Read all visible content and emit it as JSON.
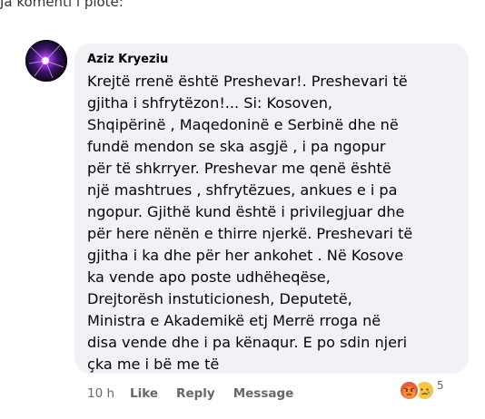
{
  "intro": {
    "text": "Ja komenti i plotë:"
  },
  "comment": {
    "author": "Aziz Kryeziu",
    "lines": [
      "Krejtë rrenë është Preshevar!. Preshevari të",
      "gjitha i shfrytëzon!... Si: Kosoven,",
      "Shqipërinë , Maqedoninë e Serbinë dhe në",
      "fundë mendon se ska asgjë , i pa ngopur",
      "për të shkrryer. Preshevar me qenë është",
      "një mashtrues , shfrytëzues, ankues e i pa",
      "ngopur. Gjithë kund është i privilegjuar dhe",
      "për here nënën e thirre njerkë. Preshevari të",
      "gjitha i ka dhe për her ankohet . Në Kosove",
      "ka vende apo poste udhëheqëse,",
      "Drejtorësh instuticionesh, Deputetë,",
      "Ministra e Akademikë etj Merrë rroga në",
      "disa vende dhe i pa kënaqur. E po sdin njeri",
      "çka me i bë me të"
    ]
  },
  "actions": {
    "time": "10 h",
    "like": "Like",
    "reply": "Reply",
    "message": "Message"
  },
  "reactions": {
    "icons": [
      "angry-reaction-icon",
      "sad-reaction-icon"
    ],
    "count": "5"
  },
  "colors": {
    "bubble": "#f0f2f5",
    "text": "#050505",
    "meta": "#65676b"
  }
}
